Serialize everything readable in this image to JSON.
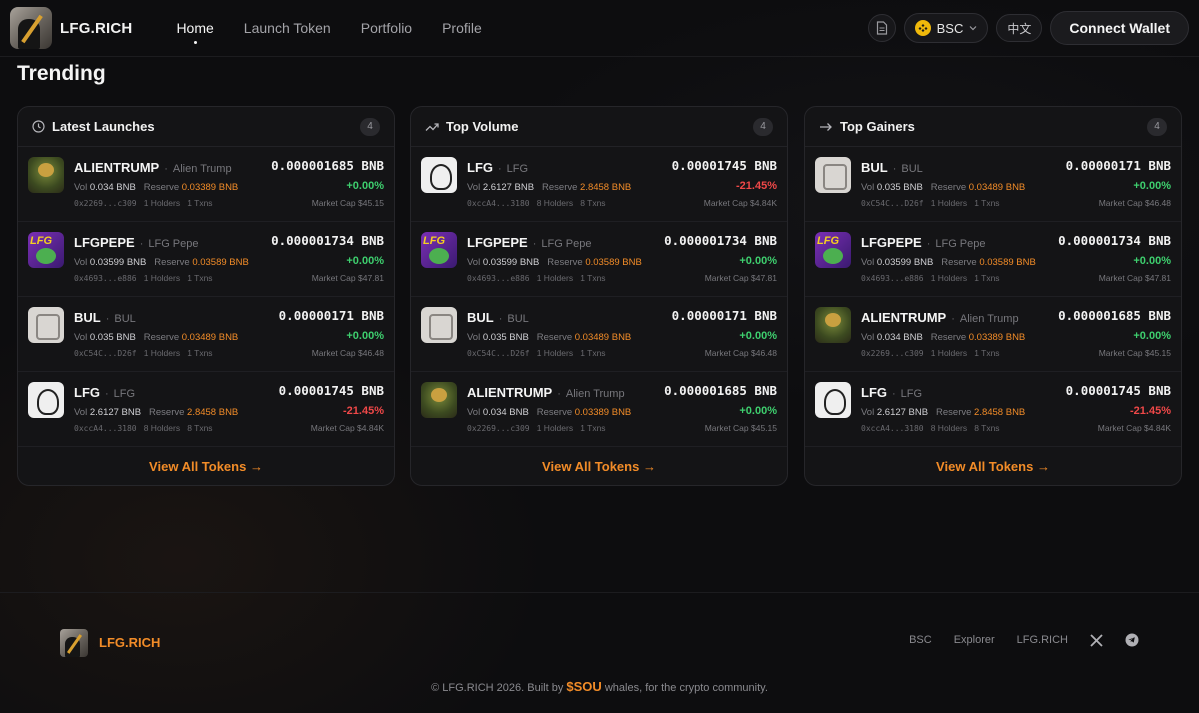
{
  "header": {
    "brand": "LFG.RICH",
    "nav": [
      "Home",
      "Launch Token",
      "Portfolio",
      "Profile"
    ],
    "chain": "BSC",
    "lang": "中文",
    "connect": "Connect Wallet"
  },
  "section_title": "Trending",
  "view_all": "View All Tokens →",
  "cards": [
    {
      "title": "Latest Launches",
      "count": "4",
      "rows": [
        {
          "sym": "ALIENTRUMP",
          "name": "Alien Trump",
          "vol": "0.034 BNB",
          "reserve": "0.03389 BNB",
          "addr": "0x2269...c309",
          "holders": "1 Holders",
          "txns": "1 Txns",
          "price": "0.000001685 BNB",
          "change": "+0.00%",
          "mcap": "Market Cap $45.15",
          "dir": "pos"
        },
        {
          "sym": "LFGPEPE",
          "name": "LFG Pepe",
          "vol": "0.03599 BNB",
          "reserve": "0.03589 BNB",
          "addr": "0x4693...e886",
          "holders": "1 Holders",
          "txns": "1 Txns",
          "price": "0.000001734 BNB",
          "change": "+0.00%",
          "mcap": "Market Cap $47.81",
          "dir": "pos"
        },
        {
          "sym": "BUL",
          "name": "BUL",
          "vol": "0.035 BNB",
          "reserve": "0.03489 BNB",
          "addr": "0xC54C...D26f",
          "holders": "1 Holders",
          "txns": "1 Txns",
          "price": "0.00000171 BNB",
          "change": "+0.00%",
          "mcap": "Market Cap $46.48",
          "dir": "pos"
        },
        {
          "sym": "LFG",
          "name": "LFG",
          "vol": "2.6127 BNB",
          "reserve": "2.8458 BNB",
          "addr": "0xccA4...3180",
          "holders": "8 Holders",
          "txns": "8 Txns",
          "price": "0.00001745 BNB",
          "change": "-21.45%",
          "mcap": "Market Cap $4.84K",
          "dir": "neg"
        }
      ]
    },
    {
      "title": "Top Volume",
      "count": "4",
      "rows": [
        {
          "sym": "LFG",
          "name": "LFG",
          "vol": "2.6127 BNB",
          "reserve": "2.8458 BNB",
          "addr": "0xccA4...3180",
          "holders": "8 Holders",
          "txns": "8 Txns",
          "price": "0.00001745 BNB",
          "change": "-21.45%",
          "mcap": "Market Cap $4.84K",
          "dir": "neg"
        },
        {
          "sym": "LFGPEPE",
          "name": "LFG Pepe",
          "vol": "0.03599 BNB",
          "reserve": "0.03589 BNB",
          "addr": "0x4693...e886",
          "holders": "1 Holders",
          "txns": "1 Txns",
          "price": "0.000001734 BNB",
          "change": "+0.00%",
          "mcap": "Market Cap $47.81",
          "dir": "pos"
        },
        {
          "sym": "BUL",
          "name": "BUL",
          "vol": "0.035 BNB",
          "reserve": "0.03489 BNB",
          "addr": "0xC54C...D26f",
          "holders": "1 Holders",
          "txns": "1 Txns",
          "price": "0.00000171 BNB",
          "change": "+0.00%",
          "mcap": "Market Cap $46.48",
          "dir": "pos"
        },
        {
          "sym": "ALIENTRUMP",
          "name": "Alien Trump",
          "vol": "0.034 BNB",
          "reserve": "0.03389 BNB",
          "addr": "0x2269...c309",
          "holders": "1 Holders",
          "txns": "1 Txns",
          "price": "0.000001685 BNB",
          "change": "+0.00%",
          "mcap": "Market Cap $45.15",
          "dir": "pos"
        }
      ]
    },
    {
      "title": "Top Gainers",
      "count": "4",
      "rows": [
        {
          "sym": "BUL",
          "name": "BUL",
          "vol": "0.035 BNB",
          "reserve": "0.03489 BNB",
          "addr": "0xC54C...D26f",
          "holders": "1 Holders",
          "txns": "1 Txns",
          "price": "0.00000171 BNB",
          "change": "+0.00%",
          "mcap": "Market Cap $46.48",
          "dir": "pos"
        },
        {
          "sym": "LFGPEPE",
          "name": "LFG Pepe",
          "vol": "0.03599 BNB",
          "reserve": "0.03589 BNB",
          "addr": "0x4693...e886",
          "holders": "1 Holders",
          "txns": "1 Txns",
          "price": "0.000001734 BNB",
          "change": "+0.00%",
          "mcap": "Market Cap $47.81",
          "dir": "pos"
        },
        {
          "sym": "ALIENTRUMP",
          "name": "Alien Trump",
          "vol": "0.034 BNB",
          "reserve": "0.03389 BNB",
          "addr": "0x2269...c309",
          "holders": "1 Holders",
          "txns": "1 Txns",
          "price": "0.000001685 BNB",
          "change": "+0.00%",
          "mcap": "Market Cap $45.15",
          "dir": "pos"
        },
        {
          "sym": "LFG",
          "name": "LFG",
          "vol": "2.6127 BNB",
          "reserve": "2.8458 BNB",
          "addr": "0xccA4...3180",
          "holders": "8 Holders",
          "txns": "8 Txns",
          "price": "0.00001745 BNB",
          "change": "-21.45%",
          "mcap": "Market Cap $4.84K",
          "dir": "neg"
        }
      ]
    }
  ],
  "labels": {
    "vol": "Vol",
    "reserve": "Reserve",
    "separator": "·"
  },
  "footer": {
    "brand": "LFG.RICH",
    "links": [
      "BSC",
      "Explorer",
      "LFG.RICH"
    ],
    "copyright_pre": "© LFG.RICH 2026. Built by",
    "copyright_token": "$SOU",
    "copyright_post": "whales, for the crypto community."
  },
  "colors": {
    "accent": "#f28c28",
    "positive": "#3ecf6e",
    "negative": "#ef4848",
    "bnb": "#f0b90b"
  }
}
